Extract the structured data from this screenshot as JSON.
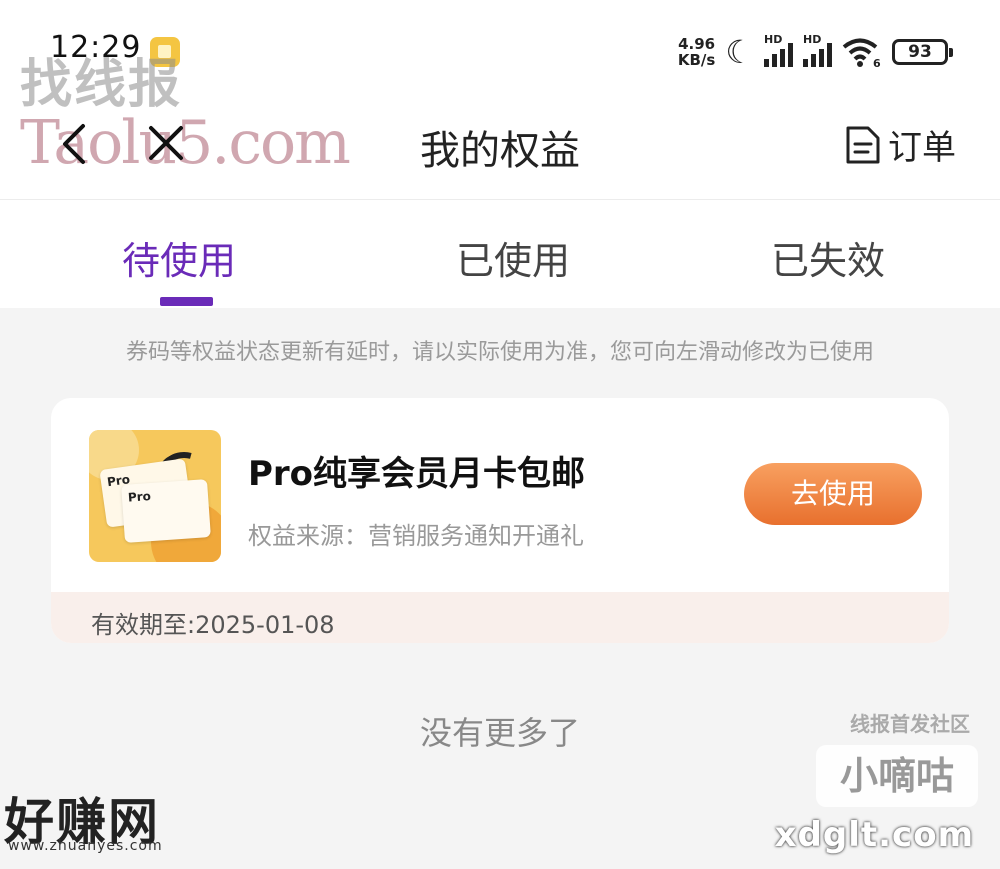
{
  "status_bar": {
    "time": "12:29",
    "net_speed_value": "4.96",
    "net_speed_unit": "KB/s",
    "hd1": "HD",
    "hd2": "HD",
    "wifi_label": "6",
    "battery": "93"
  },
  "watermarks": {
    "top_left_cn": "找线报",
    "top_left_en": "Taolu5.com",
    "right_top": "线报首发社区",
    "right_badge": "小嘀咕",
    "right_domain": "xdglt.com",
    "bottom_left": "好赚网",
    "bottom_left_url": "www.zhuanyes.com"
  },
  "header": {
    "title": "我的权益",
    "order_label": "订单"
  },
  "tabs": [
    {
      "label": "待使用",
      "active": true
    },
    {
      "label": "已使用",
      "active": false
    },
    {
      "label": "已失效",
      "active": false
    }
  ],
  "notice": "券码等权益状态更新有延时，请以实际使用为准，您可向左滑动修改为已使用",
  "benefit": {
    "thumb_text1": "Pro",
    "thumb_text2": "Pro",
    "title": "Pro纯享会员月卡包邮",
    "source": "权益来源：营销服务通知开通礼",
    "button": "去使用",
    "expiry": "有效期至:2025-01-08"
  },
  "footer_text": "没有更多了",
  "colors": {
    "accent": "#6a2bb8",
    "button_orange": "#ee7a36",
    "card_footer_bg": "#f9efeb"
  }
}
